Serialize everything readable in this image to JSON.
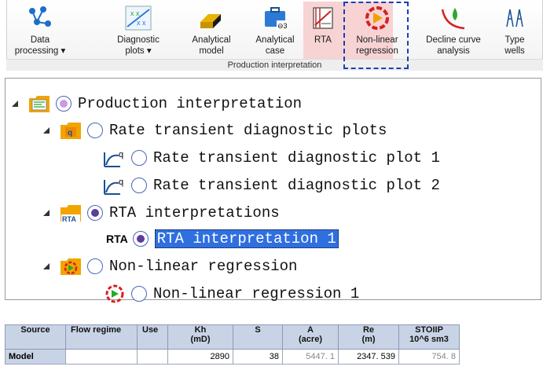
{
  "ribbon": {
    "buttons": [
      {
        "line1": "Data",
        "line2": "processing ▾"
      },
      {
        "line1": "Diagnostic",
        "line2": "plots ▾"
      },
      {
        "line1": "Analytical",
        "line2": "model"
      },
      {
        "line1": "Analytical",
        "line2": "case"
      },
      {
        "line1": "RTA",
        "line2": ""
      },
      {
        "line1": "Non-linear",
        "line2": "regression"
      },
      {
        "line1": "Decline curve",
        "line2": "analysis"
      },
      {
        "line1": "Type",
        "line2": "wells"
      }
    ],
    "group_label": "Production interpretation",
    "highlight_color": "#f7d3d4",
    "dash_color": "#1a3fb8"
  },
  "tree": {
    "root": "Production interpretation",
    "rate_transient_folder": "Rate transient diagnostic plots",
    "plot1": "Rate transient diagnostic plot 1",
    "plot2": "Rate transient diagnostic plot 2",
    "rta_folder": "RTA interpretations",
    "rta_item_icon": "RTA",
    "rta_item": "RTA interpretation 1",
    "nlr_folder": "Non-linear regression",
    "nlr_item": "Non-linear regression 1",
    "selection_color": "#2f6fe0"
  },
  "grid": {
    "headers": [
      {
        "line1": "Source",
        "line2": ""
      },
      {
        "line1": "Flow regime",
        "line2": ""
      },
      {
        "line1": "Use",
        "line2": ""
      },
      {
        "line1": "Kh",
        "line2": "(mD)"
      },
      {
        "line1": "S",
        "line2": ""
      },
      {
        "line1": "A",
        "line2": "(acre)"
      },
      {
        "line1": "Re",
        "line2": "(m)"
      },
      {
        "line1": "STOIIP",
        "line2": "10^6 sm3"
      }
    ],
    "row": {
      "source": "Model",
      "flow_regime": "",
      "use": "",
      "kh": "2890",
      "s": "38",
      "a": "5447. 1",
      "re": "2347. 539",
      "stoiip": "754. 8"
    }
  }
}
